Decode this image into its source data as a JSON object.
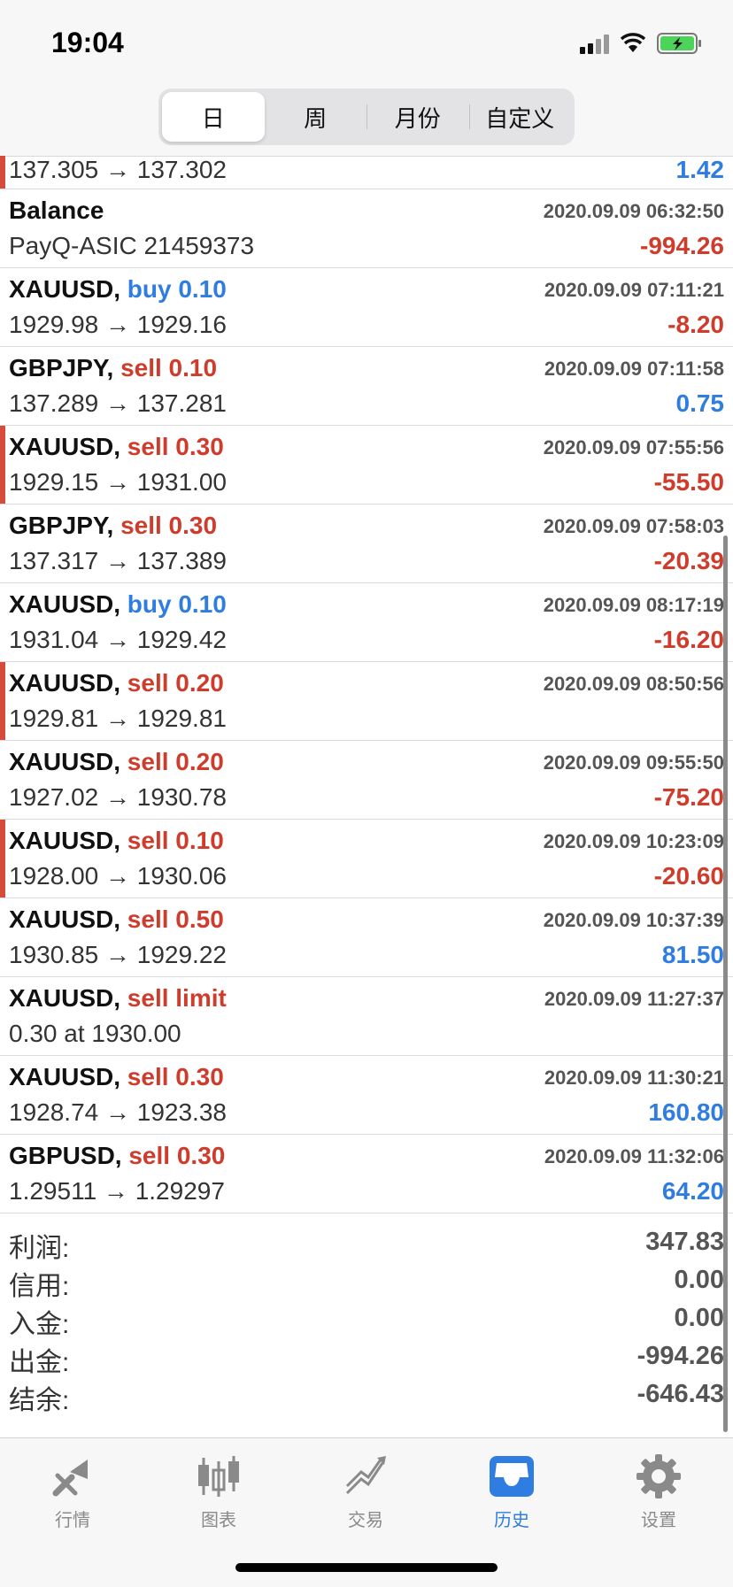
{
  "status": {
    "time": "19:04"
  },
  "segments": [
    "日",
    "周",
    "月份",
    "自定义"
  ],
  "top_partial": {
    "prices": "137.305 → 137.302",
    "amount": "1.42",
    "amount_color": "blue"
  },
  "rows": [
    {
      "symbol": "Balance",
      "action": "",
      "action_color": "",
      "time": "2020.09.09 06:32:50",
      "prices": "PayQ-ASIC 21459373",
      "amount": "-994.26",
      "amount_color": "red",
      "bar": false
    },
    {
      "symbol": "XAUUSD,",
      "action": "buy 0.10",
      "action_color": "blue",
      "time": "2020.09.09 07:11:21",
      "prices": "1929.98 → 1929.16",
      "amount": "-8.20",
      "amount_color": "red",
      "bar": false
    },
    {
      "symbol": "GBPJPY,",
      "action": "sell 0.10",
      "action_color": "red",
      "time": "2020.09.09 07:11:58",
      "prices": "137.289 → 137.281",
      "amount": "0.75",
      "amount_color": "blue",
      "bar": false
    },
    {
      "symbol": "XAUUSD,",
      "action": "sell 0.30",
      "action_color": "red",
      "time": "2020.09.09 07:55:56",
      "prices": "1929.15 → 1931.00",
      "amount": "-55.50",
      "amount_color": "red",
      "bar": true
    },
    {
      "symbol": "GBPJPY,",
      "action": "sell 0.30",
      "action_color": "red",
      "time": "2020.09.09 07:58:03",
      "prices": "137.317 → 137.389",
      "amount": "-20.39",
      "amount_color": "red",
      "bar": false
    },
    {
      "symbol": "XAUUSD,",
      "action": "buy 0.10",
      "action_color": "blue",
      "time": "2020.09.09 08:17:19",
      "prices": "1931.04 → 1929.42",
      "amount": "-16.20",
      "amount_color": "red",
      "bar": false
    },
    {
      "symbol": "XAUUSD,",
      "action": "sell 0.20",
      "action_color": "red",
      "time": "2020.09.09 08:50:56",
      "prices": "1929.81 → 1929.81",
      "amount": "",
      "amount_color": "red",
      "bar": true
    },
    {
      "symbol": "XAUUSD,",
      "action": "sell 0.20",
      "action_color": "red",
      "time": "2020.09.09 09:55:50",
      "prices": "1927.02 → 1930.78",
      "amount": "-75.20",
      "amount_color": "red",
      "bar": false
    },
    {
      "symbol": "XAUUSD,",
      "action": "sell 0.10",
      "action_color": "red",
      "time": "2020.09.09 10:23:09",
      "prices": "1928.00 → 1930.06",
      "amount": "-20.60",
      "amount_color": "red",
      "bar": true
    },
    {
      "symbol": "XAUUSD,",
      "action": "sell 0.50",
      "action_color": "red",
      "time": "2020.09.09 10:37:39",
      "prices": "1930.85 → 1929.22",
      "amount": "81.50",
      "amount_color": "blue",
      "bar": false
    },
    {
      "symbol": "XAUUSD,",
      "action": "sell limit",
      "action_color": "red",
      "time": "2020.09.09 11:27:37",
      "prices": "0.30 at 1930.00",
      "amount": "",
      "amount_color": "red",
      "bar": false
    },
    {
      "symbol": "XAUUSD,",
      "action": "sell 0.30",
      "action_color": "red",
      "time": "2020.09.09 11:30:21",
      "prices": "1928.74 → 1923.38",
      "amount": "160.80",
      "amount_color": "blue",
      "bar": false
    },
    {
      "symbol": "GBPUSD,",
      "action": "sell 0.30",
      "action_color": "red",
      "time": "2020.09.09 11:32:06",
      "prices": "1.29511 → 1.29297",
      "amount": "64.20",
      "amount_color": "blue",
      "bar": false
    }
  ],
  "summary": [
    {
      "label": "利润:",
      "value": "347.83"
    },
    {
      "label": "信用:",
      "value": "0.00"
    },
    {
      "label": "入金:",
      "value": "0.00"
    },
    {
      "label": "出金:",
      "value": "-994.26"
    },
    {
      "label": "结余:",
      "value": "-646.43"
    }
  ],
  "tabs": [
    {
      "label": "行情",
      "icon": "quotes-icon",
      "active": false
    },
    {
      "label": "图表",
      "icon": "chart-icon",
      "active": false
    },
    {
      "label": "交易",
      "icon": "trade-icon",
      "active": false
    },
    {
      "label": "历史",
      "icon": "history-icon",
      "active": true
    },
    {
      "label": "设置",
      "icon": "settings-icon",
      "active": false
    }
  ],
  "colors": {
    "red": "#cf3c2c",
    "blue": "#2f7de1",
    "accent": "#2f7de1",
    "inactive": "#8a8a8a"
  }
}
